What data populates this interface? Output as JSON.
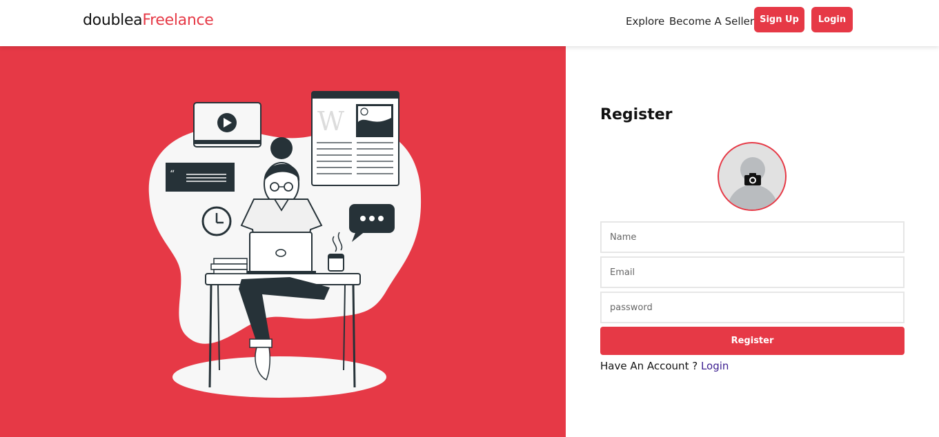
{
  "brand": {
    "part1": "doublea",
    "part2": "Freelance"
  },
  "nav": {
    "explore": "Explore",
    "become_seller": "Become A Seller",
    "signup": "Sign Up",
    "login": "Login"
  },
  "hero": {
    "illustration": "freelancer-working-at-laptop",
    "accent_color": "#e63946",
    "watermark_letter": "W"
  },
  "form": {
    "title": "Register",
    "name_placeholder": "Name",
    "email_placeholder": "Email",
    "password_placeholder": "password",
    "submit_label": "Register",
    "have_account": "Have An Account ?",
    "login_link": "Login"
  },
  "colors": {
    "primary": "#e63946",
    "dark": "#263238",
    "blob": "#f7f7f7"
  }
}
